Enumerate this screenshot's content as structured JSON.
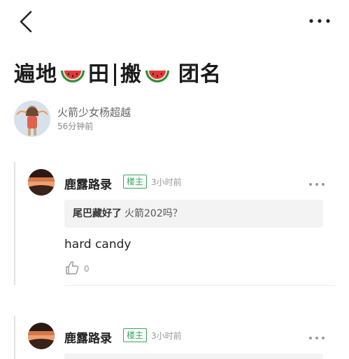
{
  "header": {
    "back_icon": "chevron-left-icon",
    "more_icon": "ellipsis-icon"
  },
  "post": {
    "title_parts": [
      "遍地",
      "田",
      "搬",
      "团名"
    ],
    "title_icon": "watermelon-icon",
    "author_name": "火箭少女杨超越",
    "posted_time": "56分钟前"
  },
  "comments": [
    {
      "user": "鹿露路录",
      "badge": "楼主",
      "time": "3小时前",
      "quote_author": "尾巴藏好了",
      "quote_text": "火箭202吗？",
      "text": "hard candy",
      "likes": "0"
    },
    {
      "user": "鹿露路录",
      "badge": "楼主",
      "time": "3小时前"
    }
  ],
  "colors": {
    "badge_green": "#3aa660",
    "quote_bg": "#f3f3f3",
    "muted_text": "#999999"
  }
}
